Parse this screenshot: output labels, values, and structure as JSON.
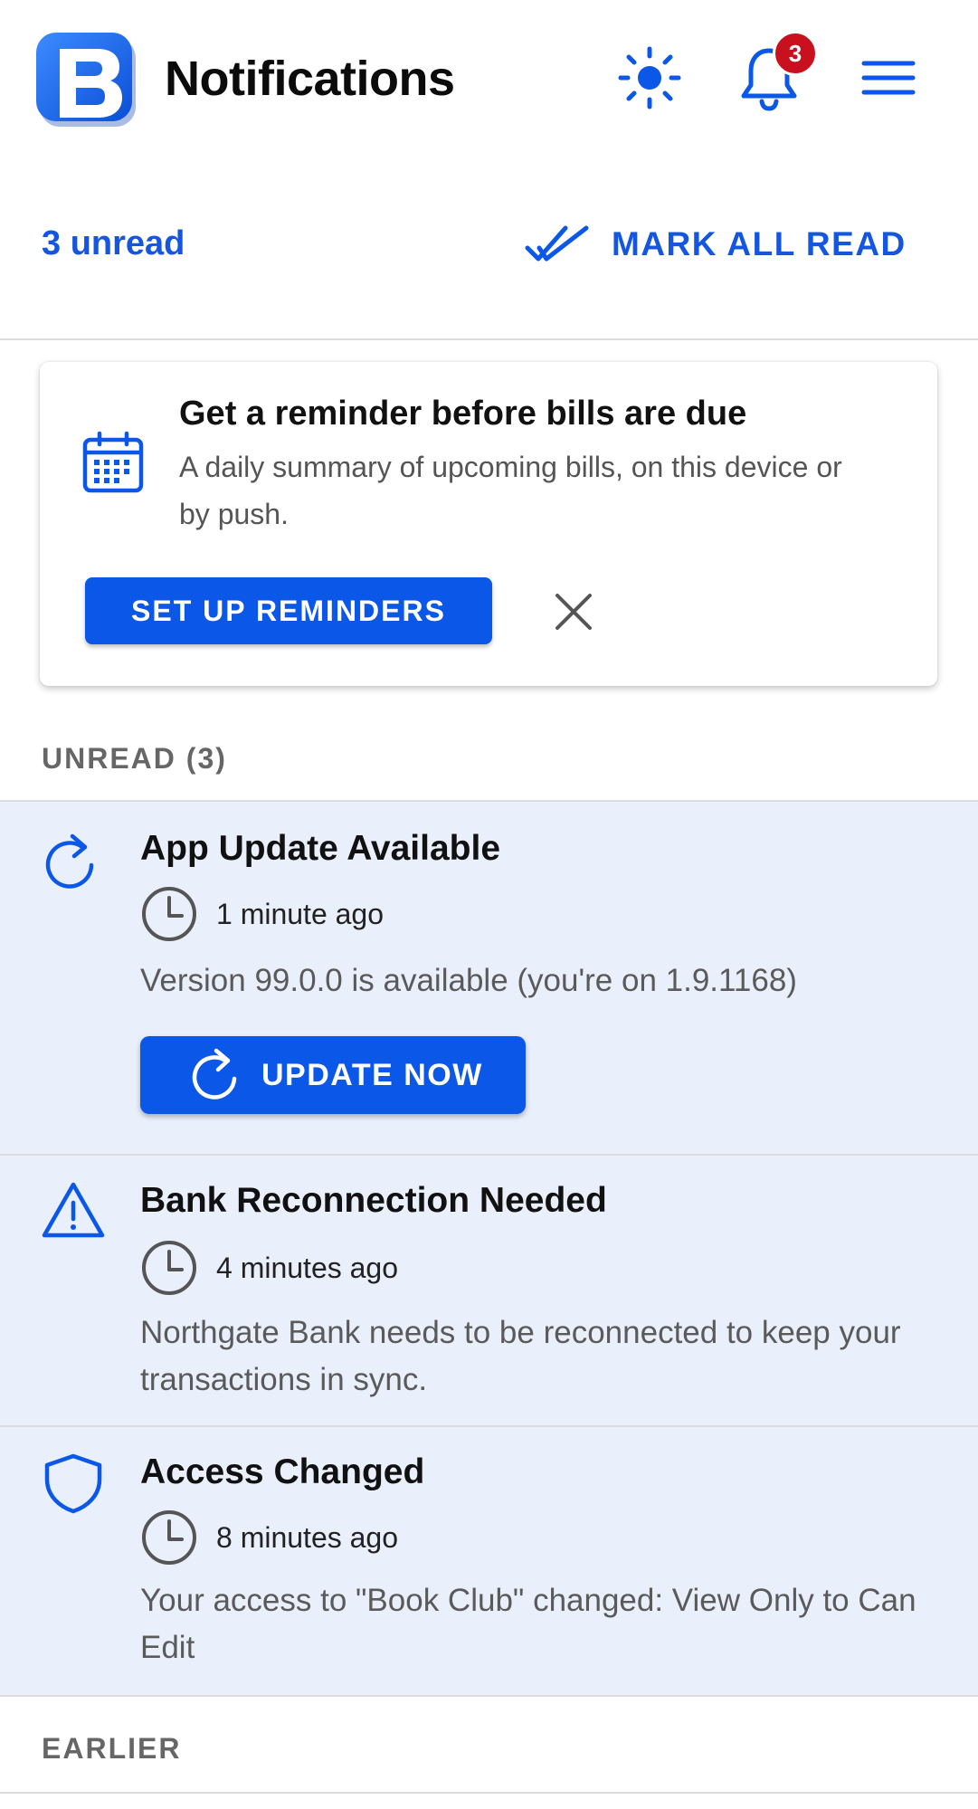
{
  "header": {
    "title": "Notifications",
    "badge_count": "3",
    "logo_letter": "B"
  },
  "subbar": {
    "unread_count": "3 unread",
    "mark_all_label": "MARK ALL READ"
  },
  "reminder": {
    "title": "Get a reminder before bills are due",
    "description": "A daily summary of upcoming bills, on this device or by push.",
    "button_label": "SET UP REMINDERS"
  },
  "sections": {
    "unread": "UNREAD (3)",
    "earlier": "EARLIER"
  },
  "notifications": [
    {
      "icon": "refresh-icon",
      "title": "App Update Available",
      "time": "1 minute ago",
      "body": "Version 99.0.0 is available (you're on 1.9.1168)",
      "action_label": "UPDATE NOW"
    },
    {
      "icon": "warning-icon",
      "title": "Bank Reconnection Needed",
      "time": "4 minutes ago",
      "body": "Northgate Bank needs to be reconnected to keep your transactions in sync."
    },
    {
      "icon": "shield-icon",
      "title": "Access Changed",
      "time": "8 minutes ago",
      "body": "Your access to \"Book Club\" changed: View Only to Can Edit"
    }
  ],
  "colors": {
    "accent": "#0a57e8",
    "link": "#1556e0",
    "badge": "#c8101e",
    "unread_bg": "#e9effb"
  }
}
